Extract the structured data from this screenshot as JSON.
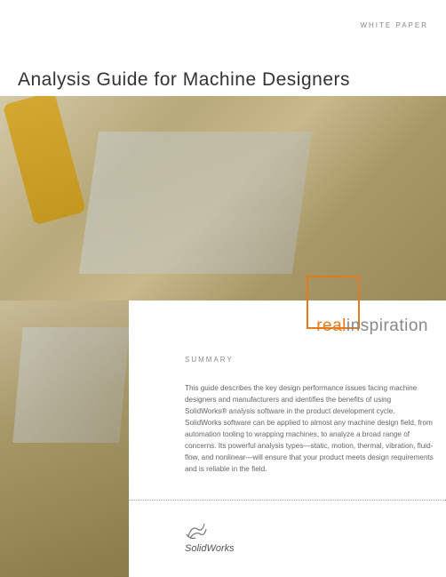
{
  "header": {
    "label": "WHITE PAPER"
  },
  "title": "Analysis Guide for Machine Designers",
  "tagline": {
    "word1": "real",
    "word2": "inspiration"
  },
  "summary": {
    "label": "SUMMARY",
    "body": "This guide describes the key design performance issues facing machine designers and manufacturers and identifies the benefits of using SolidWorks® analysis software in the product development cycle. SolidWorks software can be applied to almost any machine design field, from automation tooling to wrapping machines, to analyze a broad range of concerns. Its powerful analysis types—static, motion, thermal, vibration, fluid-flow, and nonlinear—will ensure that your product meets design requirements and is reliable in the field."
  },
  "brand": {
    "name": "SolidWorks"
  }
}
